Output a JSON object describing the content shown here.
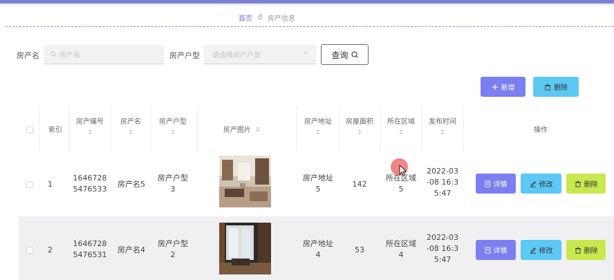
{
  "breadcrumb": {
    "home": "首页",
    "current": "房产信息"
  },
  "search": {
    "name_label": "房产名",
    "name_placeholder": "房产名",
    "type_label": "房产户型",
    "type_placeholder": "请选择房产户型",
    "query_button": "查询"
  },
  "toolbar": {
    "add": "新增",
    "delete": "删除"
  },
  "table": {
    "headers": {
      "index": "索引",
      "code": "房产编号",
      "name": "房产名",
      "type": "房产户型",
      "photo": "房产图片",
      "address": "房产地址",
      "area": "房屋面积",
      "region": "所在区域",
      "published": "发布时间",
      "actions": "操作"
    },
    "rows": [
      {
        "index": "1",
        "code_l1": "1646728",
        "code_l2": "5476533",
        "name": "房产名5",
        "type_l1": "房产户型",
        "type_l2": "3",
        "address_l1": "房产地址",
        "address_l2": "5",
        "area": "142",
        "region_l1": "所在区域",
        "region_l2": "5",
        "time_l1": "2022-03",
        "time_l2": "-08 16:3",
        "time_l3": "5:47"
      },
      {
        "index": "2",
        "code_l1": "1646728",
        "code_l2": "5476531",
        "name": "房产名4",
        "type_l1": "房产户型",
        "type_l2": "2",
        "address_l1": "房产地址",
        "address_l2": "4",
        "area": "53",
        "region_l1": "所在区域",
        "region_l2": "4",
        "time_l1": "2022-03",
        "time_l2": "-08 16:3",
        "time_l3": "5:47"
      }
    ],
    "actions": {
      "detail": "详情",
      "edit": "修改",
      "delete": "删除"
    }
  },
  "colors": {
    "accent": "#7b7ff0",
    "info": "#5cc8f4",
    "warning": "#c8e94e",
    "topbar": "#7b7fd6"
  }
}
